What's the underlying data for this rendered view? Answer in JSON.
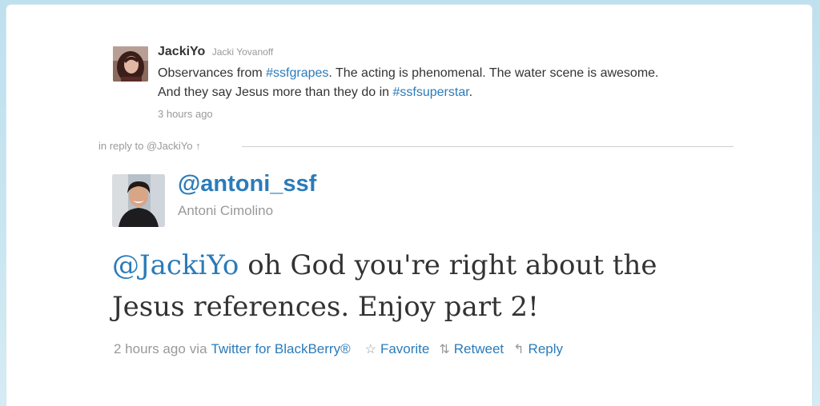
{
  "original_tweet": {
    "username": "JackiYo",
    "display_name": "Jacki Yovanoff",
    "text_parts": {
      "a": "Observances from ",
      "hashtag1": "#ssfgrapes",
      "b": ". The acting is phenomenal. The water scene is awesome. And they say Jesus more than they do in ",
      "hashtag2": "#ssfsuperstar",
      "c": "."
    },
    "time": "3 hours ago"
  },
  "in_reply_to": "in reply to @JackiYo ↑",
  "reply_tweet": {
    "username": "@antoni_ssf",
    "display_name": "Antoni Cimolino",
    "mention": "@JackiYo",
    "text": " oh God you're right about the Jesus references. Enjoy part 2!",
    "time": "2 hours ago",
    "via_label": "via",
    "source": "Twitter for BlackBerry®",
    "actions": {
      "favorite": "Favorite",
      "retweet": "Retweet",
      "reply": "Reply"
    }
  },
  "colors": {
    "link": "#2b7bb9",
    "text": "#333333",
    "muted": "#999999"
  },
  "icons": {
    "favorite": "star-icon",
    "retweet": "retweet-icon",
    "reply": "reply-arrow-icon"
  }
}
